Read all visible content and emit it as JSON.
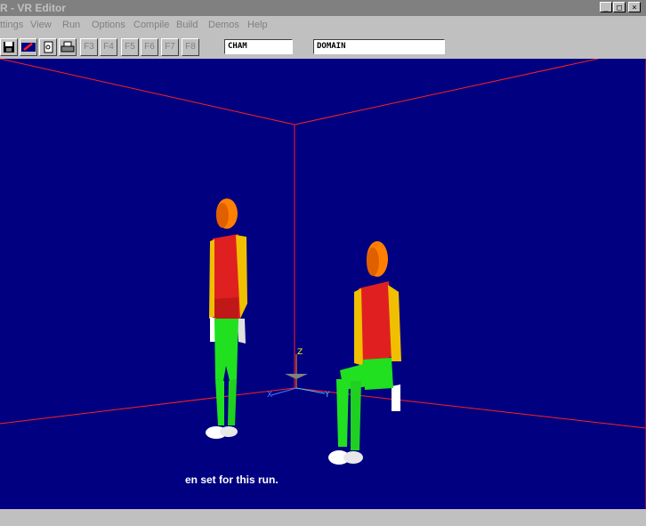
{
  "window": {
    "title": "R - VR Editor",
    "controls": [
      "_",
      "□",
      "×"
    ]
  },
  "menu": [
    "ttings",
    "View",
    "Run",
    "Options",
    "Compile",
    "Build",
    "Demos",
    "Help"
  ],
  "toolbar": {
    "fkeys": [
      "F3",
      "F4",
      "F5",
      "F6",
      "F7",
      "F8"
    ],
    "field1": "CHAM",
    "field2": "DOMAIN"
  },
  "viewport": {
    "axes": {
      "x": "X",
      "y": "Y",
      "z": "Z"
    },
    "status_message": "en set for this run."
  },
  "colors": {
    "background": "#000080",
    "edges": "#ff2020",
    "head": "#ff8000",
    "torso": "#e02020",
    "arms": "#f0c000",
    "legs": "#20e020",
    "hands_feet": "#ffffff"
  }
}
